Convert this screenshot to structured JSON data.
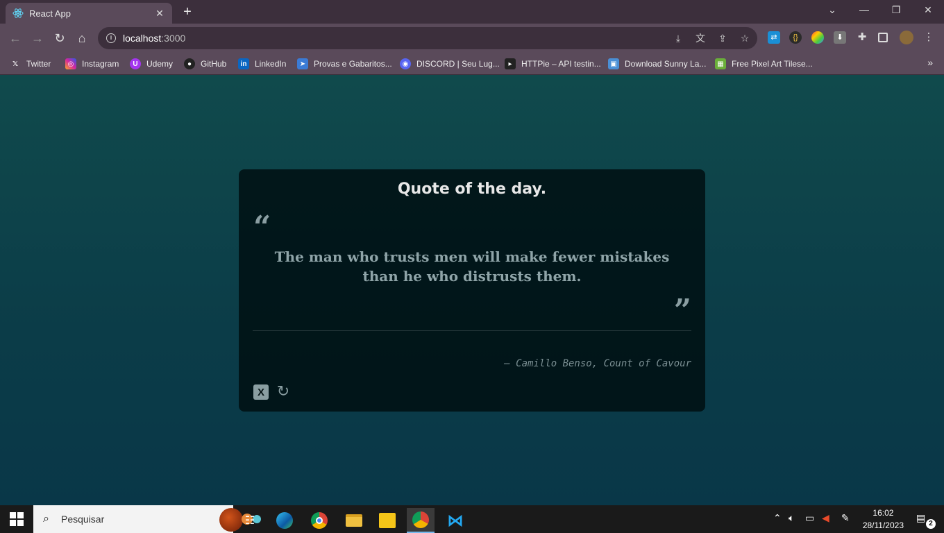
{
  "browser": {
    "tab_title": "React App",
    "address": {
      "host": "localhost",
      "port": ":3000"
    },
    "bookmarks": [
      {
        "label": "Twitter",
        "icon": "x-logo-icon",
        "color": "#000000"
      },
      {
        "label": "Instagram",
        "icon": "instagram-icon",
        "color": "#d6249f"
      },
      {
        "label": "Udemy",
        "icon": "udemy-icon",
        "color": "#a435f0"
      },
      {
        "label": "GitHub",
        "icon": "github-icon",
        "color": "#222222"
      },
      {
        "label": "LinkedIn",
        "icon": "linkedin-icon",
        "color": "#0a66c2"
      },
      {
        "label": "Provas e Gabaritos...",
        "icon": "provas-icon",
        "color": "#3b7bd6"
      },
      {
        "label": "DISCORD | Seu Lug...",
        "icon": "discord-icon",
        "color": "#5865f2"
      },
      {
        "label": "HTTPie – API testin...",
        "icon": "httpie-icon",
        "color": "#222222"
      },
      {
        "label": "Download Sunny La...",
        "icon": "image-icon",
        "color": "#4a8fd6"
      },
      {
        "label": "Free Pixel Art Tilese...",
        "icon": "pixel-art-icon",
        "color": "#6aaf3a"
      }
    ]
  },
  "quote_card": {
    "title": "Quote of the day.",
    "text": "The man who trusts men will make fewer mistakes than he who distrusts them.",
    "author": "– Camillo Benso, Count of Cavour",
    "tweet_icon": "X",
    "colors": {
      "card_bg": "#031416",
      "accent": "#8a9ea2"
    }
  },
  "taskbar": {
    "search_placeholder": "Pesquisar",
    "time": "16:02",
    "date": "28/11/2023",
    "notification_count": "2"
  }
}
